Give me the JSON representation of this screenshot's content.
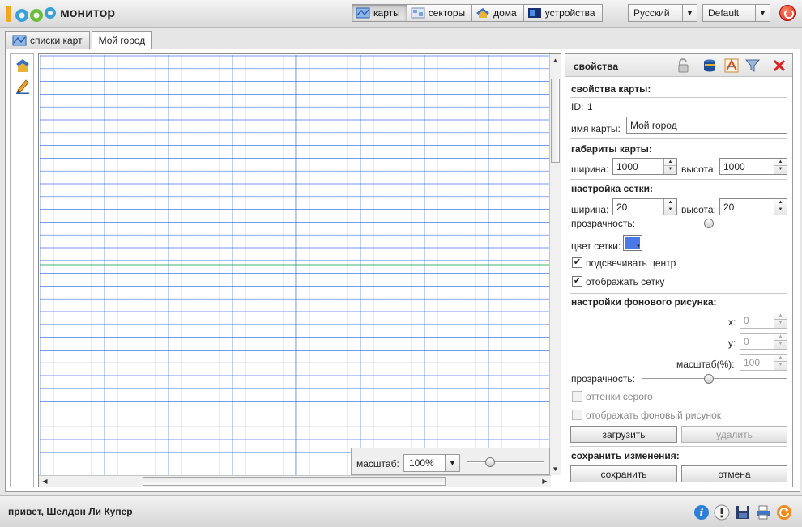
{
  "app": {
    "title": "монитор"
  },
  "nav": {
    "items": [
      {
        "label": "карты",
        "icon": "map-icon",
        "active": true
      },
      {
        "label": "секторы",
        "icon": "sectors-icon",
        "active": false
      },
      {
        "label": "дома",
        "icon": "house-icon",
        "active": false
      },
      {
        "label": "устройства",
        "icon": "device-icon",
        "active": false
      }
    ],
    "language": "Русский",
    "theme": "Default"
  },
  "tabs": [
    {
      "label": "списки карт",
      "icon": "map-list-icon",
      "selected": false
    },
    {
      "label": "Мой город",
      "selected": true
    }
  ],
  "map": {
    "zoom_label": "масштаб:",
    "zoom_value": "100%",
    "zoom_slider_fraction": 0.3
  },
  "props": {
    "title": "свойства",
    "map_props_title": "свойства карты:",
    "id_label": "ID:",
    "id_value": "1",
    "name_label": "имя карты:",
    "name_value": "Мой город",
    "size_title": "габариты карты:",
    "width_label": "ширина:",
    "height_label": "высота:",
    "map_width": "1000",
    "map_height": "1000",
    "grid_title": "настройка сетки:",
    "grid_width": "20",
    "grid_height": "20",
    "opacity_label": "прозрачность:",
    "grid_opacity_fraction": 0.46,
    "grid_color_label": "цвет сетки:",
    "grid_color": "#4a78e6",
    "highlight_center_label": "подсвечивать центр",
    "highlight_center": true,
    "show_grid_label": "отображать сетку",
    "show_grid": true,
    "bg_title": "настройки фонового рисунка:",
    "x_label": "x:",
    "x_value": "0",
    "y_label": "y:",
    "y_value": "0",
    "scale_label": "масштаб(%):",
    "scale_value": "100",
    "bg_opacity_fraction": 0.46,
    "grayscale_label": "оттенки серого",
    "show_bg_label": "отображать фоновый рисунок",
    "upload_label": "загрузить",
    "delete_label": "удалить",
    "save_title": "сохранить изменения:",
    "save_label": "сохранить",
    "cancel_label": "отмена"
  },
  "footer": {
    "greeting": "привет, Шелдон Ли Купер"
  },
  "colors": {
    "grid_line": "#4a78e6",
    "center_line": "#3cb371"
  }
}
